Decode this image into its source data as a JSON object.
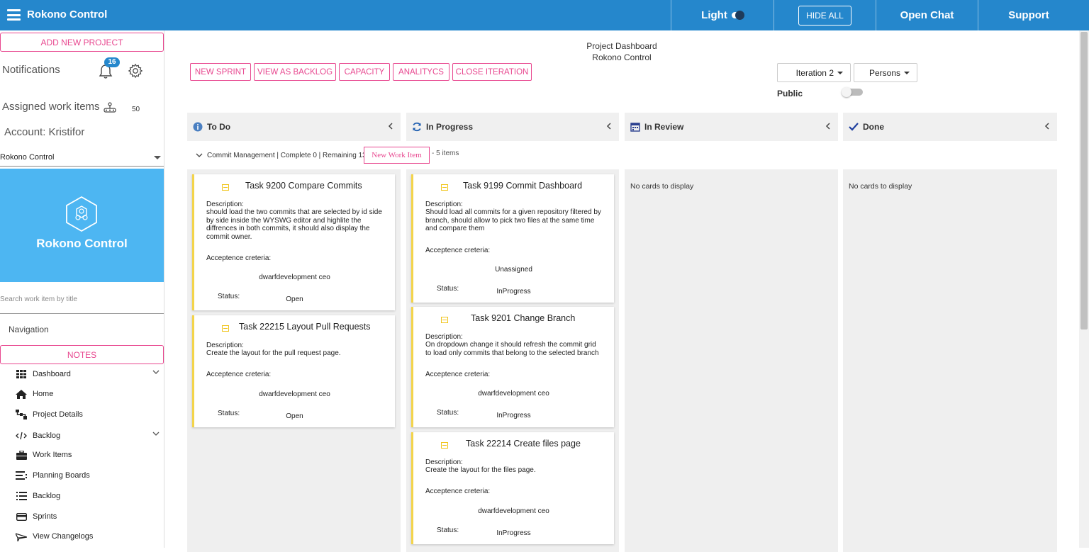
{
  "header": {
    "app_title": "Rokono Control",
    "theme_label": "Light",
    "hide_all_label": "HIDE ALL",
    "open_chat_label": "Open Chat",
    "support_label": "Support"
  },
  "sidebar": {
    "add_project_label": "ADD NEW PROJECT",
    "notifications_label": "Notifications",
    "notifications_count": "16",
    "assigned_label": "Assigned work items",
    "assigned_count": "50",
    "account_label": "Account: Kristifor",
    "project_selected": "Rokono Control",
    "project_name": "Rokono Control",
    "search_placeholder": "Search work item by title",
    "navigation_label": "Navigation",
    "notes_label": "NOTES",
    "nav_items": [
      {
        "label": "Dashboard",
        "icon": "grid-icon"
      },
      {
        "label": "Home",
        "icon": "home-icon"
      },
      {
        "label": "Project Details",
        "icon": "sitemap-icon"
      },
      {
        "label": "Backlog",
        "icon": "code-icon"
      },
      {
        "label": "Work Items",
        "icon": "briefcase-icon"
      },
      {
        "label": "Planning Boards",
        "icon": "stream-icon"
      },
      {
        "label": "Backlog",
        "icon": "list-icon"
      },
      {
        "label": "Sprints",
        "icon": "credit-card-icon"
      },
      {
        "label": "View Changelogs",
        "icon": "plane-icon"
      }
    ]
  },
  "main": {
    "title": "Project Dashboard",
    "subtitle": "Rokono Control",
    "actions": {
      "new_sprint": "NEW SPRINT",
      "view_backlog": "VIEW AS BACKLOG",
      "capacity": "CAPACITY",
      "analytics": "ANALITYCS",
      "close_iteration": "CLOSE ITERATION"
    },
    "iteration_select": "Iteration 2",
    "persons_select": "Persons",
    "public_label": "Public",
    "columns": [
      {
        "title": "To Do",
        "icon": "info-icon"
      },
      {
        "title": "In Progress",
        "icon": "sync-icon"
      },
      {
        "title": "In Review",
        "icon": "calendar-icon"
      },
      {
        "title": "Done",
        "icon": "check-icon"
      }
    ],
    "group": {
      "summary": "Commit Management | Complete 0 | Remaining 13",
      "new_work_item_label": "New Work Item",
      "items_count": "- 5 items"
    },
    "empty_message": "No cards to display",
    "card_labels": {
      "description": "Description:",
      "acceptance": "Acceptence creteria:",
      "status": "Status:"
    },
    "todo_cards": [
      {
        "title": "Task 9200 Compare Commits",
        "description": "should load the two commits that are selected by id side by side inside the WYSWG editor and highlite the diffrences in both commits, it should also display the commit owner.",
        "assignee": "dwarfdevelopment ceo",
        "status": "Open"
      },
      {
        "title": "Task 22215 Layout Pull Requests",
        "description": "Create the layout for the pull request page.",
        "assignee": "dwarfdevelopment ceo",
        "status": "Open"
      }
    ],
    "inprogress_cards": [
      {
        "title": "Task 9199 Commit Dashboard",
        "description": "Should load all commits for a given repository filtered by branch, should allow to pick two files at the same time and compare them",
        "assignee": "Unassigned",
        "status": "InProgress"
      },
      {
        "title": "Task 9201 Change Branch",
        "description": "On dropdown change it should refresh the commit grid to load only commits that belong to the selected branch",
        "assignee": "dwarfdevelopment ceo",
        "status": "InProgress"
      },
      {
        "title": "Task 22214 Create files page",
        "description": "Create the layout for the files page.",
        "assignee": "dwarfdevelopment ceo",
        "status": "InProgress"
      }
    ]
  },
  "colors": {
    "header_bg": "#2587cc",
    "accent_pink": "#e8478f",
    "hero_bg": "#4db6f2",
    "card_accent": "#f3d44b",
    "lane_bg": "#efefef"
  }
}
